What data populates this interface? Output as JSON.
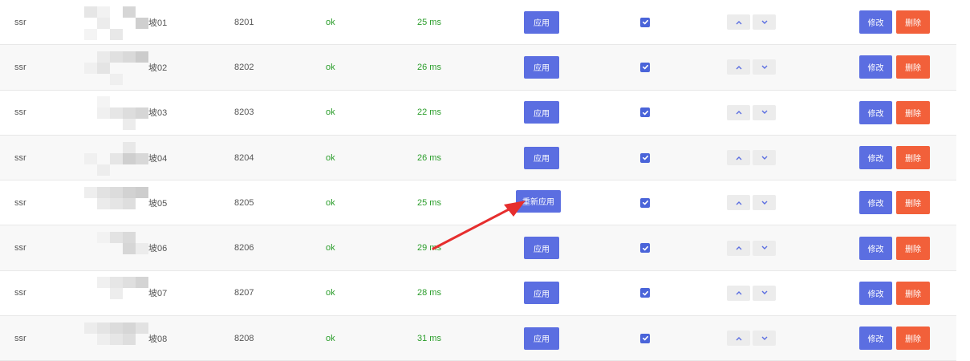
{
  "colors": {
    "primary": "#5b6ee1",
    "danger": "#f2603a",
    "success": "#2a9d2a",
    "annotation_arrow": "#e62e2e"
  },
  "labels": {
    "apply": "应用",
    "reapply": "重新应用",
    "edit": "修改",
    "delete": "删除"
  },
  "rows": [
    {
      "type": "ssr",
      "name_suffix": "坡01",
      "port": "8201",
      "status": "ok",
      "latency": "25 ms",
      "apply_label": "应用",
      "checked": true
    },
    {
      "type": "ssr",
      "name_suffix": "坡02",
      "port": "8202",
      "status": "ok",
      "latency": "26 ms",
      "apply_label": "应用",
      "checked": true
    },
    {
      "type": "ssr",
      "name_suffix": "坡03",
      "port": "8203",
      "status": "ok",
      "latency": "22 ms",
      "apply_label": "应用",
      "checked": true
    },
    {
      "type": "ssr",
      "name_suffix": "坡04",
      "port": "8204",
      "status": "ok",
      "latency": "26 ms",
      "apply_label": "应用",
      "checked": true
    },
    {
      "type": "ssr",
      "name_suffix": "坡05",
      "port": "8205",
      "status": "ok",
      "latency": "25 ms",
      "apply_label": "重新应用",
      "checked": true
    },
    {
      "type": "ssr",
      "name_suffix": "坡06",
      "port": "8206",
      "status": "ok",
      "latency": "29 ms",
      "apply_label": "应用",
      "checked": true
    },
    {
      "type": "ssr",
      "name_suffix": "坡07",
      "port": "8207",
      "status": "ok",
      "latency": "28 ms",
      "apply_label": "应用",
      "checked": true
    },
    {
      "type": "ssr",
      "name_suffix": "坡08",
      "port": "8208",
      "status": "ok",
      "latency": "31 ms",
      "apply_label": "应用",
      "checked": true
    }
  ],
  "icons": {
    "checkbox": "checkmark-icon",
    "move_up": "chevron-up-icon",
    "move_down": "chevron-down-icon",
    "annotation": "red-arrow-annotation"
  }
}
